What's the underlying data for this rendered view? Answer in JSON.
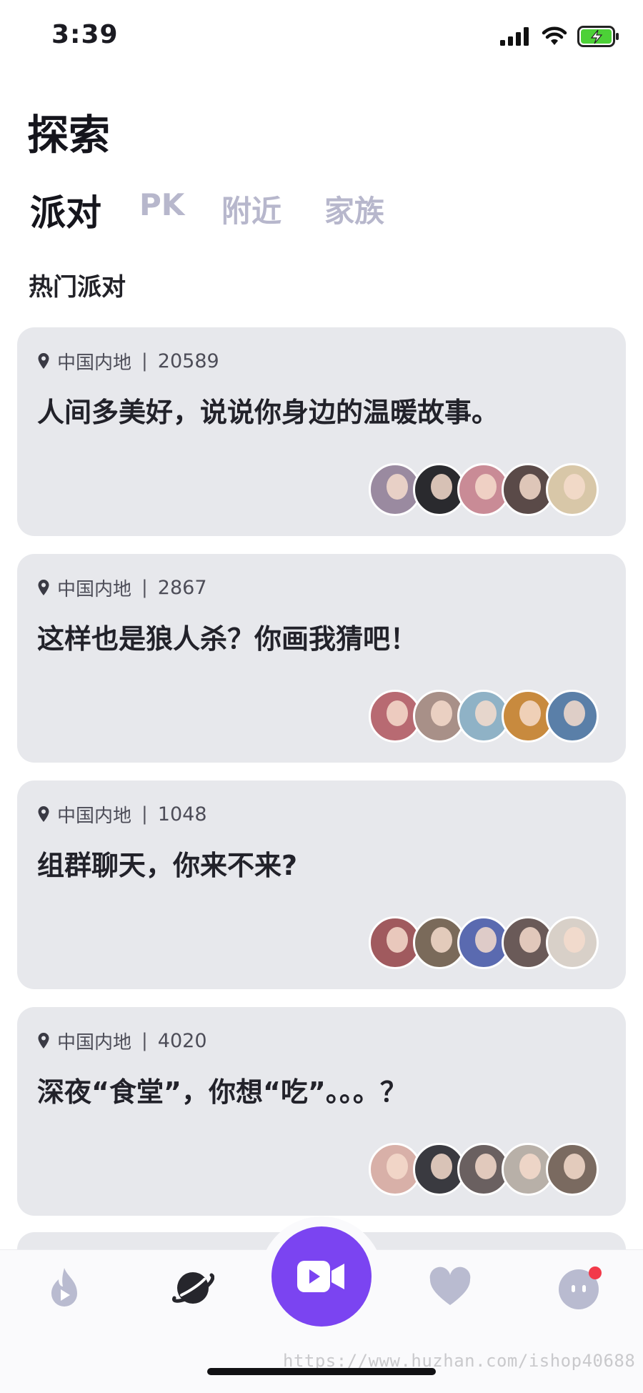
{
  "status_bar": {
    "time": "3:39"
  },
  "header": {
    "title": "探索"
  },
  "tabs": [
    {
      "label": "派对",
      "active": true
    },
    {
      "label": "PK",
      "active": false
    },
    {
      "label": "附近",
      "active": false
    },
    {
      "label": "家族",
      "active": false
    }
  ],
  "section": {
    "title": "热门派对"
  },
  "parties": [
    {
      "location": "中国内地",
      "count": "20589",
      "title": "人间多美好，说说你身边的温暖故事。",
      "avatar_colors": [
        "#9a8aa0",
        "#2a2a2e",
        "#c98b96",
        "#5a4a48",
        "#d8c7a8"
      ]
    },
    {
      "location": "中国内地",
      "count": "2867",
      "title": "这样也是狼人杀？你画我猜吧！",
      "avatar_colors": [
        "#b86a72",
        "#a89088",
        "#8fb2c6",
        "#c88a3e",
        "#5a7fa8"
      ]
    },
    {
      "location": "中国内地",
      "count": "1048",
      "title": "组群聊天，你来不来?",
      "avatar_colors": [
        "#a05a5e",
        "#7a6a5a",
        "#5a6ab0",
        "#6a5a58",
        "#d8d0c8"
      ]
    },
    {
      "location": "中国内地",
      "count": "4020",
      "title": "深夜“食堂”，你想“吃”。。。？",
      "avatar_colors": [
        "#d8b0a8",
        "#3a3a40",
        "#6a6060",
        "#b8b0a8",
        "#7a6a60"
      ]
    }
  ],
  "bottom_nav": {
    "items": [
      "flame-icon",
      "planet-icon",
      "video-camera-icon",
      "heart-icon",
      "profile-face-icon"
    ],
    "accent": "#7b44f1",
    "badge_color": "#f23a4a"
  },
  "watermark": "https://www.huzhan.com/ishop40688"
}
